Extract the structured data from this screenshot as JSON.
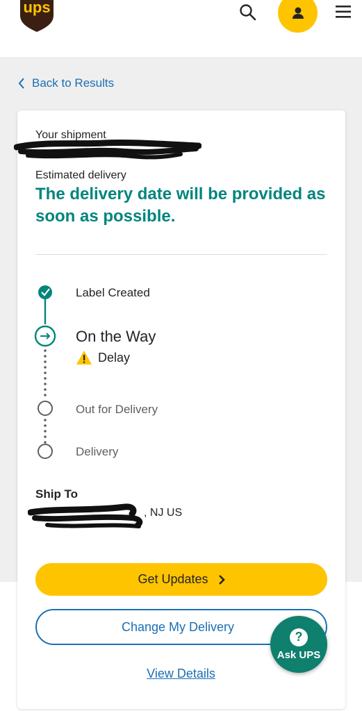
{
  "brand": {
    "logo_text": "ups",
    "primary_color": "#ffc400",
    "accent_color": "#00857d",
    "link_color": "#1a6fb4",
    "logo_brown": "#3b1f12"
  },
  "header": {
    "search_icon": "search-icon",
    "account_icon": "user-icon",
    "menu_icon": "hamburger-menu-icon"
  },
  "nav": {
    "back_label": "Back to Results"
  },
  "shipment": {
    "label": "Your shipment",
    "estimated_label": "Estimated delivery",
    "estimated_message": "The delivery date will be provided as soon as possible."
  },
  "timeline": {
    "steps": [
      {
        "label": "Label Created",
        "state": "complete"
      },
      {
        "label": "On the Way",
        "state": "current"
      },
      {
        "label": "Out for Delivery",
        "state": "pending"
      },
      {
        "label": "Delivery",
        "state": "pending"
      }
    ],
    "status_label": "Delay"
  },
  "ship_to": {
    "label": "Ship To",
    "visible_address": ", NJ US"
  },
  "actions": {
    "get_updates": "Get Updates",
    "change_delivery": "Change My Delivery",
    "view_details": "View Details"
  },
  "ask_ups": {
    "label": "Ask UPS",
    "icon_glyph": "?"
  }
}
